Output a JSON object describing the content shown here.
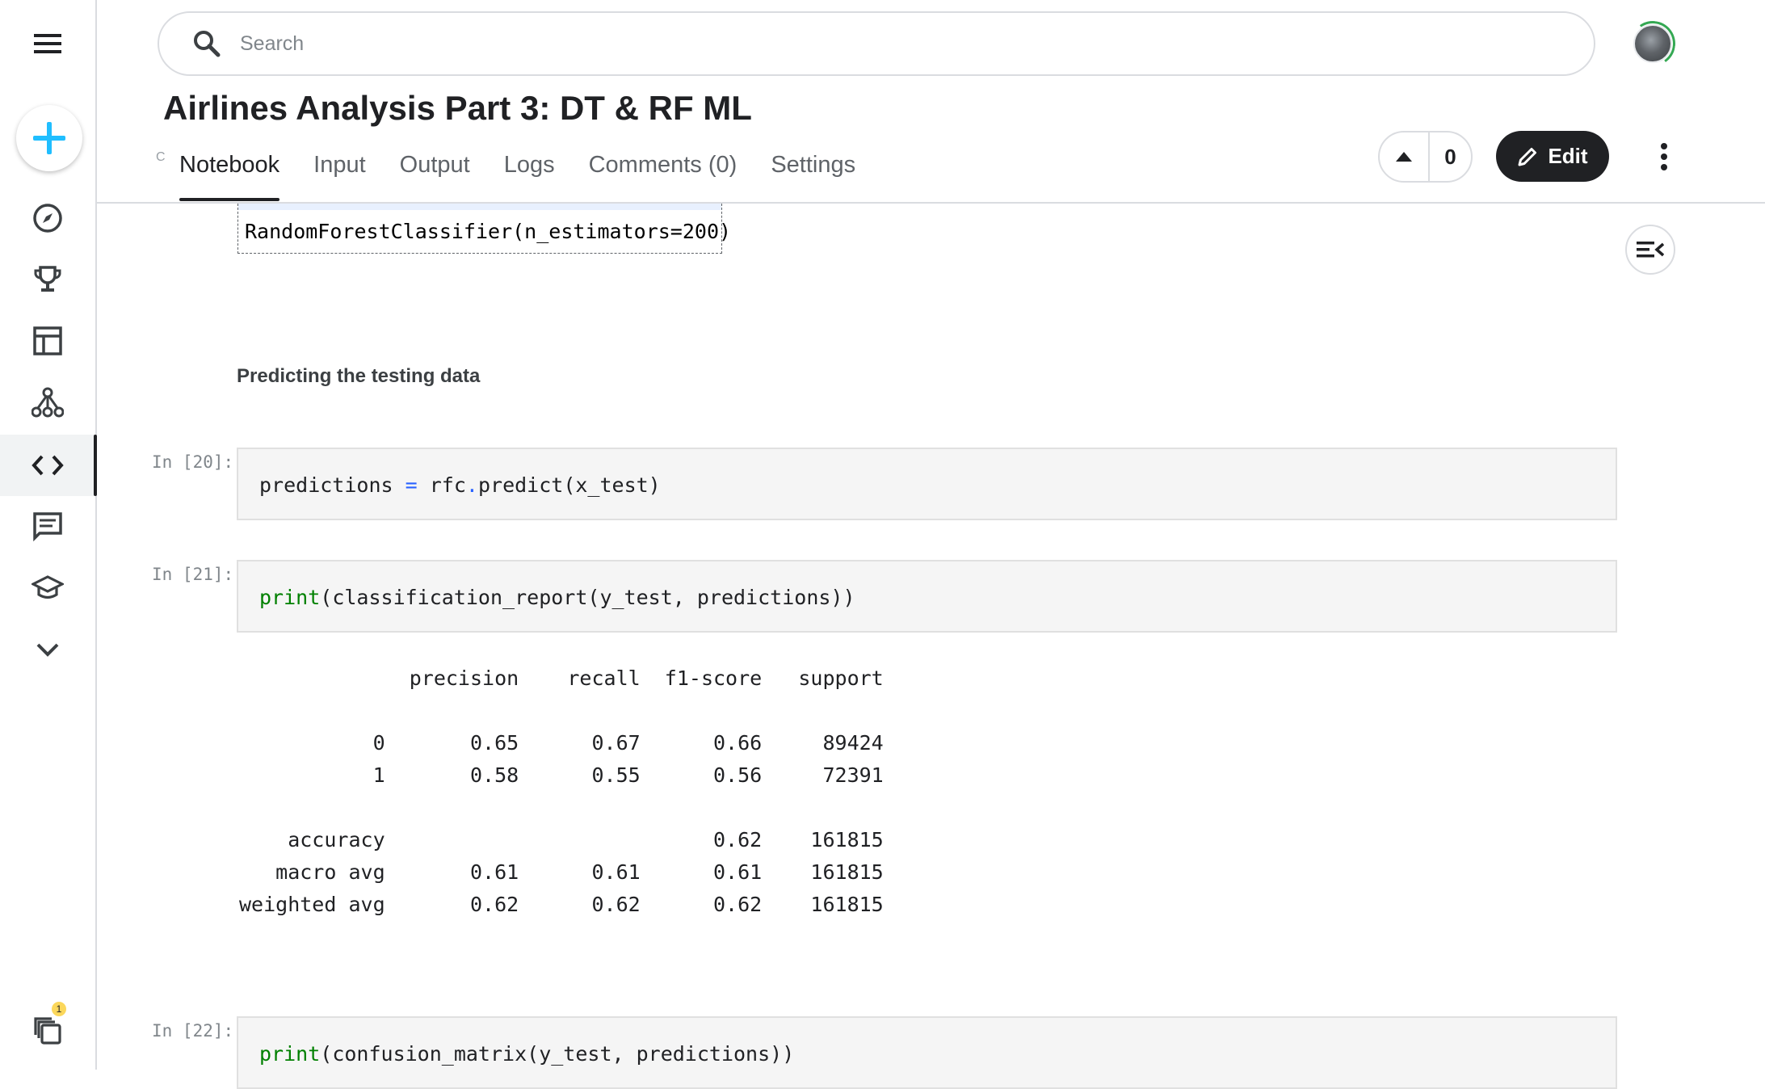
{
  "search": {
    "placeholder": "Search"
  },
  "notebook": {
    "title": "Airlines Analysis Part 3: DT & RF ML",
    "stub": "C"
  },
  "tabs": [
    "Notebook",
    "Input",
    "Output",
    "Logs",
    "Comments (0)",
    "Settings"
  ],
  "actions": {
    "upvotes": "0",
    "edit_label": "Edit"
  },
  "sidebar": {
    "items": [
      "menu-icon",
      "create-icon",
      "compass-icon",
      "trophy-icon",
      "table-icon",
      "models-icon",
      "code-icon",
      "comments-icon",
      "school-icon",
      "chevron-down-icon",
      "notifications-icon"
    ],
    "notification_count": "1"
  },
  "cells": {
    "rf_output": "RandomForestClassifier(n_estimators=200)",
    "markdown_heading": "Predicting the testing data",
    "cell20": {
      "prompt": "In [20]:",
      "lhs": "predictions ",
      "op": "=",
      "rhs": " rfc",
      "dot": ".",
      "call": "predict(x_test)"
    },
    "cell21": {
      "prompt": "In [21]:",
      "fn": "print",
      "args": "(classification_report(y_test, predictions))"
    },
    "cell22": {
      "prompt": "In [22]:",
      "fn": "print",
      "args": "(confusion_matrix(y_test, predictions))"
    },
    "report": {
      "header": "              precision    recall  f1-score   support",
      "rows": [
        "           0       0.65      0.67      0.66     89424",
        "           1       0.58      0.55      0.56     72391",
        "",
        "    accuracy                           0.62    161815",
        "   macro avg       0.61      0.61      0.61    161815",
        "weighted avg       0.62      0.62      0.62    161815"
      ]
    }
  },
  "colors": {
    "accent": "#20beff",
    "keyword": "#008000",
    "operator": "#2962ff",
    "dark": "#202124"
  }
}
